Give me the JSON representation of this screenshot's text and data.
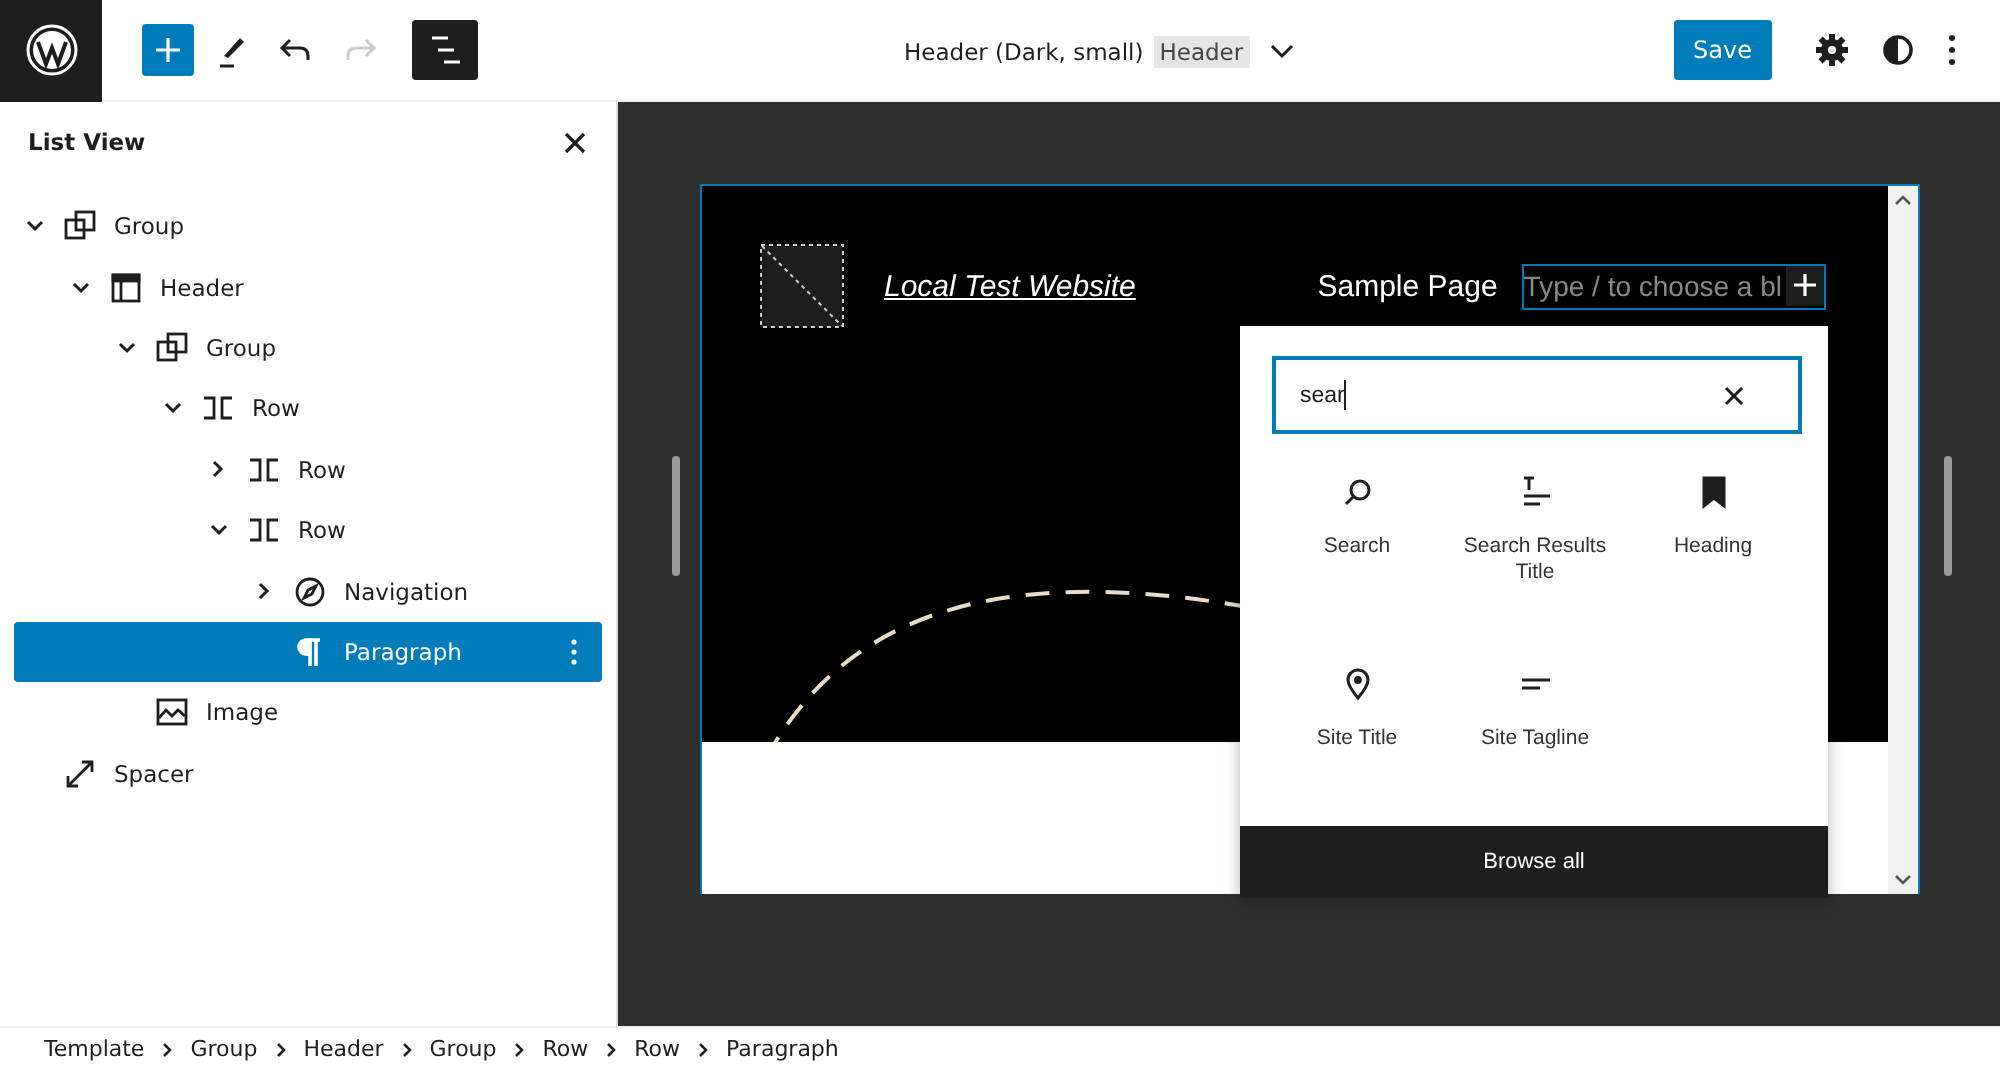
{
  "toolbar": [
    {
      "kind": "inserter"
    },
    {
      "kind": "tools"
    },
    {
      "kind": "undo",
      "disabled": false
    },
    {
      "kind": "redo",
      "disabled": true
    },
    {
      "kind": "list_view",
      "pressed": true
    }
  ],
  "document": {
    "title": "Header (Dark, small)",
    "badge": "Header"
  },
  "actions": {
    "save": "Save"
  },
  "list_view": {
    "title": "List View",
    "items": [
      {
        "label": "Group",
        "kind": "group",
        "expanded": true,
        "selected": false,
        "children": [
          {
            "label": "Header",
            "kind": "header",
            "expanded": true,
            "selected": false,
            "children": [
              {
                "label": "Group",
                "kind": "group",
                "expanded": true,
                "selected": false,
                "children": [
                  {
                    "label": "Row",
                    "kind": "row",
                    "expanded": true,
                    "selected": false,
                    "children": [
                      {
                        "label": "Row",
                        "kind": "row",
                        "expanded": false,
                        "selected": false
                      },
                      {
                        "label": "Row",
                        "kind": "row",
                        "expanded": true,
                        "selected": false,
                        "children": [
                          {
                            "label": "Navigation",
                            "kind": "navigation",
                            "expanded": false,
                            "selected": false
                          },
                          {
                            "label": "Paragraph",
                            "kind": "paragraph",
                            "selected": true
                          }
                        ]
                      }
                    ]
                  }
                ]
              },
              {
                "label": "Image",
                "kind": "image",
                "selected": false
              }
            ]
          }
        ]
      },
      {
        "label": "Spacer",
        "kind": "spacer",
        "selected": false
      }
    ]
  },
  "canvas": {
    "site_title": "Local Test Website",
    "nav_link": "Sample Page",
    "paragraph_placeholder": "Type / to choose a bl"
  },
  "inserter": {
    "search_value": "sear",
    "results": [
      {
        "label": "Search",
        "kind": "search"
      },
      {
        "label": "Search Results Title",
        "kind": "search_results_title"
      },
      {
        "label": "Heading",
        "kind": "heading"
      },
      {
        "label": "Site Title",
        "kind": "site_title"
      },
      {
        "label": "Site Tagline",
        "kind": "site_tagline"
      }
    ],
    "browse_all": "Browse all"
  },
  "breadcrumbs": [
    "Template",
    "Group",
    "Header",
    "Group",
    "Row",
    "Row",
    "Paragraph"
  ]
}
